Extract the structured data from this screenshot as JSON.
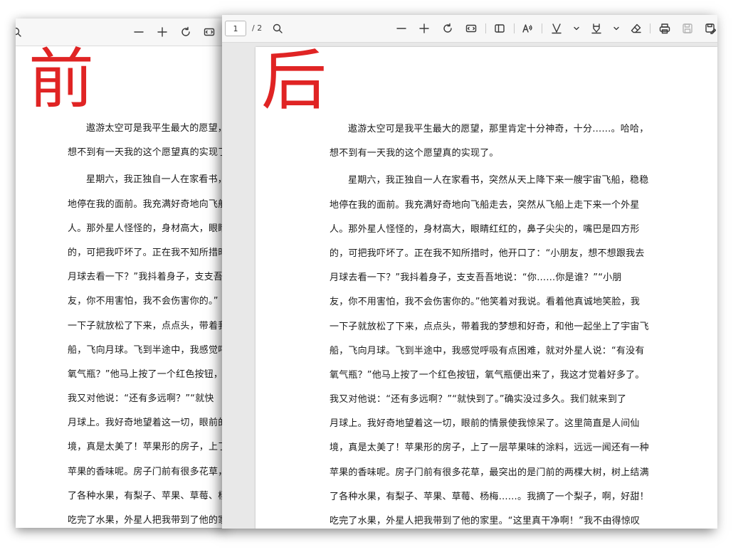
{
  "before": {
    "label": "前",
    "lines": [
      "遨游太空可是我平生最大的愿望，",
      "想不到有一天我的这个愿望真的实现了",
      "星期六，我正独自一人在家看书，",
      "地停在我的面前。我充满好奇地向飞船",
      "人。那外星人怪怪的，身材高大，眼睛",
      "的，可把我吓坏了。正在我不知所措时",
      "月球去看一下？”我抖着身子，支支吾",
      "友，你不用害怕，我不会伤害你的。”",
      "一下子就放松了下来，点点头，带着我",
      "船，飞向月球。飞到半途中，我感觉呼",
      "氧气瓶？”他马上按了一个红色按钮，",
      "我又对他说：“还有多远啊？”“就快",
      "月球上。我好奇地望着这一切，眼前的",
      "境，真是太美了！苹果形的房子，上了",
      "苹果的香味呢。房子门前有很多花草，",
      "了各种水果，有梨子、苹果、草莓、杨",
      "吃完了水果，外星人把我带到了他的家"
    ]
  },
  "after": {
    "label": "后",
    "toolbar": {
      "page_current": "1",
      "page_total": "/ 2"
    },
    "lines": [
      "遨游太空可是我平生最大的愿望，那里肯定十分神奇，十分……。哈哈，",
      "想不到有一天我的这个愿望真的实现了。",
      "星期六，我正独自一人在家看书，突然从天上降下来一艘宇宙飞船，稳稳",
      "地停在我的面前。我充满好奇地向飞船走去，突然从飞船上走下来一个外星",
      "人。那外星人怪怪的，身材高大，眼睛红红的，鼻子尖尖的，嘴巴是四方形",
      "的，可把我吓坏了。正在我不知所措时，他开口了：“小朋友，想不想跟我去",
      "月球去看一下？”我抖着身子，支支吾吾地说：“你……你是谁？”“小朋",
      "友，你不用害怕，我不会伤害你的。”他笑着对我说。看着他真诚地笑脸，我",
      "一下子就放松了下来，点点头，带着我的梦想和好奇，和他一起坐上了宇宙飞",
      "船，飞向月球。飞到半途中，我感觉呼吸有点困难，就对外星人说：“有没有",
      "氧气瓶？”他马上按了一个红色按钮，氧气瓶便出来了，我这才觉着好多了。",
      "我又对他说：“还有多远啊？”“就快到了。”确实没过多久。我们就来到了",
      "月球上。我好奇地望着这一切，眼前的情景使我惊呆了。这里简直是人间仙",
      "境，真是太美了！苹果形的房子，上了一层苹果味的涂料，远远一闻还有一种",
      "苹果的香味呢。房子门前有很多花草，最突出的是门前的两棵大树，树上结满",
      "了各种水果，有梨子、苹果、草莓、杨梅……。我摘了一个梨子，啊，好甜！",
      "吃完了水果，外星人把我带到了他的家里。“这里真干净啊！”我不由得惊叹"
    ]
  }
}
